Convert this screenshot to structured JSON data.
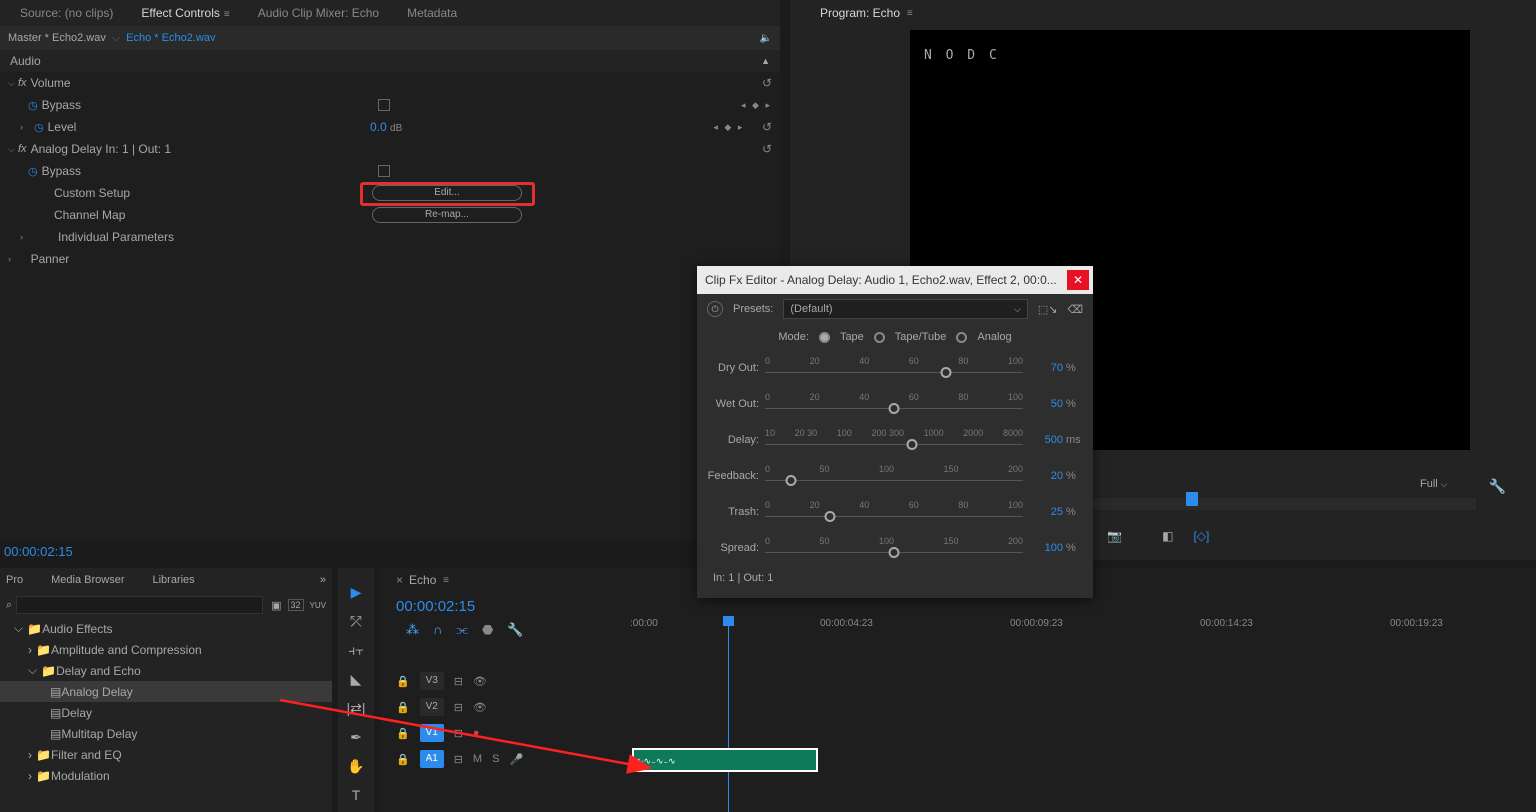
{
  "topbar": {
    "source": "Source: (no clips)",
    "effect_controls": "Effect Controls",
    "mixer": "Audio Clip Mixer: Echo",
    "metadata": "Metadata"
  },
  "ec": {
    "master": "Master * Echo2.wav",
    "clip": "Echo * Echo2.wav",
    "audio": "Audio",
    "volume": "Volume",
    "bypass": "Bypass",
    "level": "Level",
    "level_val": "0.0",
    "db": "dB",
    "analog": "Analog Delay  In: 1 | Out: 1",
    "custom": "Custom Setup",
    "edit": "Edit...",
    "channel": "Channel Map",
    "remap": "Re-map...",
    "individual": "Individual Parameters",
    "panner": "Panner",
    "fx": "fx"
  },
  "timecode_left": "00:00:02:15",
  "program": {
    "title": "Program: Echo",
    "nodc": "N O   D C",
    "res": "Full"
  },
  "fxbrowser": {
    "pro": "Pro",
    "media": "Media Browser",
    "libraries": "Libraries",
    "more": "»",
    "audio_effects": "Audio Effects",
    "amp": "Amplitude and Compression",
    "delay_echo": "Delay and Echo",
    "analog_delay": "Analog Delay",
    "delay": "Delay",
    "multitap": "Multitap Delay",
    "filter_eq": "Filter and EQ",
    "modulation": "Modulation"
  },
  "timeline": {
    "title": "Echo",
    "tc": "00:00:02:15",
    "ruler": [
      ":00:00",
      "00:00:04:23",
      "00:00:09:23",
      "00:00:14:23",
      "00:00:19:23"
    ],
    "tracks": {
      "v3": "V3",
      "v2": "V2",
      "v1": "V1",
      "a1": "A1",
      "m": "M",
      "s": "S"
    }
  },
  "fxeditor": {
    "title": "Clip Fx Editor - Analog Delay: Audio 1, Echo2.wav, Effect 2, 00:0...",
    "presets_label": "Presets:",
    "preset": "(Default)",
    "mode": "Mode:",
    "tape": "Tape",
    "tapetube": "Tape/Tube",
    "analog": "Analog",
    "rows": [
      {
        "label": "Dry Out:",
        "ticks": [
          "0",
          "20",
          "40",
          "60",
          "80",
          "100"
        ],
        "value": "70",
        "unit": "%",
        "pos": 70
      },
      {
        "label": "Wet Out:",
        "ticks": [
          "0",
          "20",
          "40",
          "60",
          "80",
          "100"
        ],
        "value": "50",
        "unit": "%",
        "pos": 50
      },
      {
        "label": "Delay:",
        "ticks": [
          "10",
          "20 30",
          "100",
          "200 300",
          "1000",
          "2000",
          "8000"
        ],
        "value": "500",
        "unit": "ms",
        "pos": 57
      },
      {
        "label": "Feedback:",
        "ticks": [
          "0",
          "50",
          "100",
          "150",
          "200"
        ],
        "value": "20",
        "unit": "%",
        "pos": 10
      },
      {
        "label": "Trash:",
        "ticks": [
          "0",
          "20",
          "40",
          "60",
          "80",
          "100"
        ],
        "value": "25",
        "unit": "%",
        "pos": 25
      },
      {
        "label": "Spread:",
        "ticks": [
          "0",
          "50",
          "100",
          "150",
          "200"
        ],
        "value": "100",
        "unit": "%",
        "pos": 50
      }
    ],
    "io": "In: 1 | Out: 1"
  }
}
